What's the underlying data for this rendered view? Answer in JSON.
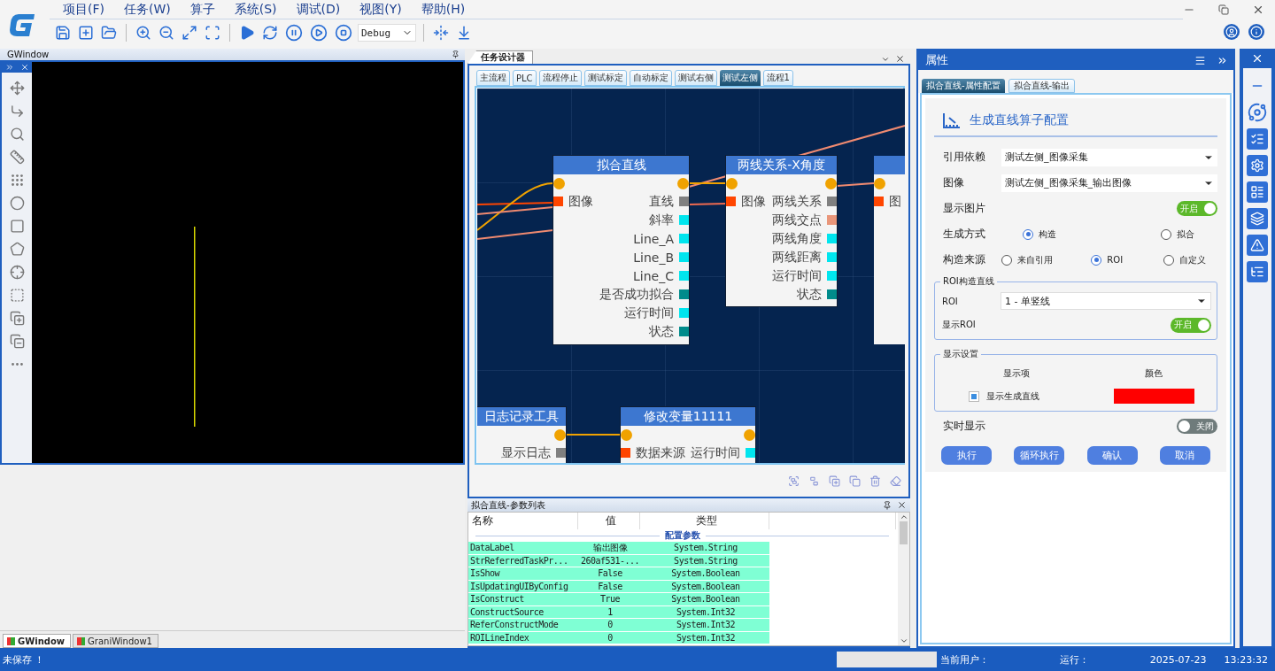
{
  "title_bar": {
    "menu": [
      "项目(F)",
      "任务(W)",
      "算子",
      "系统(S)",
      "调试(D)",
      "视图(Y)",
      "帮助(H)"
    ],
    "build_config": "Debug"
  },
  "image_window": {
    "title": "GWindow",
    "tabs": [
      {
        "label": "GWindow",
        "selected": true
      },
      {
        "label": "GraniWindow1",
        "selected": false
      }
    ]
  },
  "designer": {
    "title": "任务设计器",
    "tabs": [
      {
        "label": "主流程",
        "selected": false
      },
      {
        "label": "PLC",
        "selected": false
      },
      {
        "label": "流程停止",
        "selected": false
      },
      {
        "label": "测试标定",
        "selected": false
      },
      {
        "label": "自动标定",
        "selected": false
      },
      {
        "label": "测试右侧",
        "selected": false
      },
      {
        "label": "测试左侧",
        "selected": true
      },
      {
        "label": "流程1",
        "selected": false
      }
    ],
    "nodes": [
      {
        "title": "拟合直线",
        "inputs": [
          "图像"
        ],
        "outputs": [
          {
            "label": "直线",
            "color": "#808080"
          },
          {
            "label": "斜率",
            "color": "#00e5ee"
          },
          {
            "label": "Line_A",
            "color": "#00e5ee"
          },
          {
            "label": "Line_B",
            "color": "#00e5ee"
          },
          {
            "label": "Line_C",
            "color": "#00e5ee"
          },
          {
            "label": "是否成功拟合",
            "color": "#008b8b"
          },
          {
            "label": "运行时间",
            "color": "#00e5ee"
          },
          {
            "label": "状态",
            "color": "#008b8b"
          }
        ]
      },
      {
        "title": "两线关系-X角度",
        "inputs": [
          "图像"
        ],
        "outputs": [
          {
            "label": "两线关系",
            "color": "#808080"
          },
          {
            "label": "两线交点",
            "color": "#e9967a"
          },
          {
            "label": "两线角度",
            "color": "#00e5ee"
          },
          {
            "label": "两线距离",
            "color": "#00e5ee"
          },
          {
            "label": "运行时间",
            "color": "#00e5ee"
          },
          {
            "label": "状态",
            "color": "#008b8b"
          }
        ]
      },
      {
        "inputs": [
          "图"
        ]
      },
      {
        "title": "日志记录工具",
        "outputs": [
          {
            "label": "显示日志",
            "color": "#808080"
          }
        ]
      },
      {
        "title": "修改变量11111",
        "inputs": [
          "数据来源"
        ],
        "outputs": [
          {
            "label": "运行时间",
            "color": "#00e5ee"
          }
        ]
      }
    ]
  },
  "parameter_list": {
    "title": "拟合直线-参数列表",
    "columns": [
      "名称",
      "值",
      "类型"
    ],
    "section": "配置参数",
    "rows": [
      [
        "DataLabel",
        "输出图像",
        "System.String"
      ],
      [
        "StrReferredTaskPr...",
        "260af531-...",
        "System.String"
      ],
      [
        "IsShow",
        "False",
        "System.Boolean"
      ],
      [
        "IsUpdatingUIByConfig",
        "False",
        "System.Boolean"
      ],
      [
        "IsConstruct",
        "True",
        "System.Boolean"
      ],
      [
        "ConstructSource",
        "1",
        "System.Int32"
      ],
      [
        "ReferConstructMode",
        "0",
        "System.Int32"
      ],
      [
        "ROILineIndex",
        "0",
        "System.Int32"
      ]
    ]
  },
  "properties": {
    "title": "属性",
    "tabs": [
      {
        "label": "拟合直线-属性配置",
        "selected": true
      },
      {
        "label": "拟合直线-输出",
        "selected": false
      }
    ],
    "heading": "生成直线算子配置",
    "fields": [
      {
        "label": "引用依赖",
        "value": "测试左侧_图像采集"
      },
      {
        "label": "图像",
        "value": "测试左侧_图像采集_输出图像"
      }
    ],
    "show_image": {
      "label": "显示图片",
      "on": true,
      "text": "开启"
    },
    "generation": {
      "label": "生成方式",
      "options": [
        {
          "label": "构造",
          "selected": true
        },
        {
          "label": "拟合",
          "selected": false
        }
      ]
    },
    "source": {
      "label": "构造来源",
      "options": [
        {
          "label": "来自引用",
          "selected": false
        },
        {
          "label": "ROI",
          "selected": true
        },
        {
          "label": "自定义",
          "selected": false
        }
      ]
    },
    "roi_group": {
      "title": "ROI构造直线",
      "roi": {
        "label": "ROI",
        "value": "1 - 单竖线"
      },
      "show_roi": {
        "label": "显示ROI",
        "on": true,
        "text": "开启"
      }
    },
    "display_group": {
      "title": "显示设置",
      "columns": [
        "显示项",
        "颜色"
      ],
      "items": [
        {
          "label": "显示生成直线",
          "checked": true,
          "color": "#ff0000"
        }
      ]
    },
    "realtime": {
      "label": "实时显示",
      "on": false,
      "text": "关闭"
    },
    "buttons": [
      "执行",
      "循环执行",
      "确认",
      "取消"
    ]
  },
  "status_bar": {
    "save_state": "未保存 ！",
    "user_label": "当前用户：",
    "run_label": "运行：",
    "date": "2025-07-23",
    "time": "13:23:32"
  }
}
